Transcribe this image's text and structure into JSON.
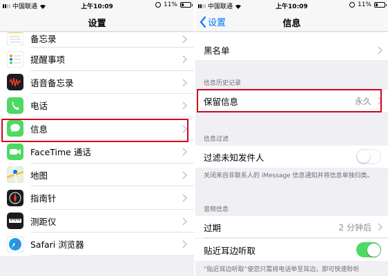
{
  "status_bar": {
    "carrier": "中国联通",
    "time": "上午10:09",
    "battery": "11%"
  },
  "left": {
    "nav_title": "设置",
    "items": [
      {
        "label": "备忘录",
        "icon": "notes-icon",
        "color": "#ffffff"
      },
      {
        "label": "提醒事项",
        "icon": "reminders-icon",
        "color": "#ffffff"
      },
      {
        "label": "语音备忘录",
        "icon": "voice-memos-icon",
        "color": "#1c1c1e"
      },
      {
        "label": "电话",
        "icon": "phone-icon",
        "color": "#4cd964"
      },
      {
        "label": "信息",
        "icon": "messages-icon",
        "color": "#4cd964"
      },
      {
        "label": "FaceTime 通话",
        "icon": "facetime-icon",
        "color": "#4cd964"
      },
      {
        "label": "地图",
        "icon": "maps-icon",
        "color": "#e8f0e0"
      },
      {
        "label": "指南针",
        "icon": "compass-icon",
        "color": "#1c1c1e"
      },
      {
        "label": "测距仪",
        "icon": "measure-icon",
        "color": "#1c1c1e"
      },
      {
        "label": "Safari 浏览器",
        "icon": "safari-icon",
        "color": "#ffffff"
      }
    ]
  },
  "right": {
    "back_label": "设置",
    "nav_title": "信息",
    "blacklist": "黑名单",
    "history_header": "信息历史记录",
    "keep_messages": {
      "label": "保留信息",
      "value": "永久"
    },
    "filter_header": "信息过滤",
    "filter_unknown": {
      "label": "过滤未知发件人",
      "on": false
    },
    "filter_note": "关闭来自非联系人的 iMessage 信息通知并将信息单独归类。",
    "audio_header": "音频信息",
    "expire": {
      "label": "过期",
      "value": "2 分钟后"
    },
    "raise_to_listen": {
      "label": "贴近耳边听取",
      "on": true
    },
    "raise_note": "“贴近耳边听取”使您只需将电话举至耳边，即可快速聆听"
  },
  "colors": {
    "accent": "#007aff",
    "highlight": "#d0021b",
    "toggle_on": "#4cd964"
  }
}
